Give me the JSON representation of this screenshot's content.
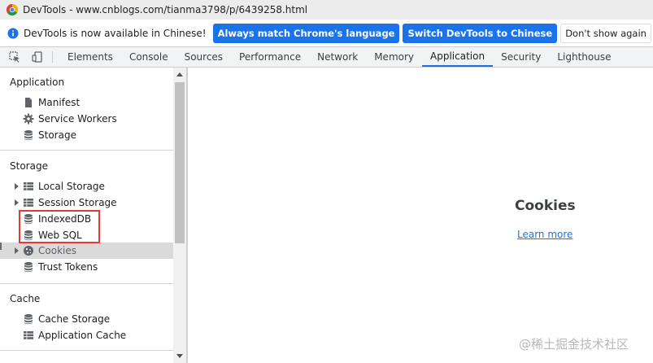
{
  "window": {
    "title": "DevTools - www.cnblogs.com/tianma3798/p/6439258.html"
  },
  "infobar": {
    "message": "DevTools is now available in Chinese!",
    "buttons": [
      "Always match Chrome's language",
      "Switch DevTools to Chinese",
      "Don't show again"
    ]
  },
  "tabs": [
    "Elements",
    "Console",
    "Sources",
    "Performance",
    "Network",
    "Memory",
    "Application",
    "Security",
    "Lighthouse"
  ],
  "active_tab": "Application",
  "sidebar": {
    "application": {
      "title": "Application",
      "items": [
        {
          "label": "Manifest",
          "icon": "document-icon"
        },
        {
          "label": "Service Workers",
          "icon": "gear-icon"
        },
        {
          "label": "Storage",
          "icon": "database-icon"
        }
      ]
    },
    "storage": {
      "title": "Storage",
      "items": [
        {
          "label": "Local Storage",
          "icon": "grid-icon",
          "expandable": true
        },
        {
          "label": "Session Storage",
          "icon": "grid-icon",
          "expandable": true
        },
        {
          "label": "IndexedDB",
          "icon": "database-icon"
        },
        {
          "label": "Web SQL",
          "icon": "database-icon"
        },
        {
          "label": "Cookies",
          "icon": "cookie-icon",
          "expandable": true,
          "selected": true
        },
        {
          "label": "Trust Tokens",
          "icon": "database-icon"
        }
      ]
    },
    "cache": {
      "title": "Cache",
      "items": [
        {
          "label": "Cache Storage",
          "icon": "database-icon"
        },
        {
          "label": "Application Cache",
          "icon": "grid-icon"
        }
      ]
    }
  },
  "main": {
    "title": "Cookies",
    "link": "Learn more"
  },
  "watermark": "@稀土掘金技术社区",
  "colors": {
    "accent": "#1a73e8",
    "highlight_box": "#e53935",
    "selected_row": "#dadada"
  }
}
